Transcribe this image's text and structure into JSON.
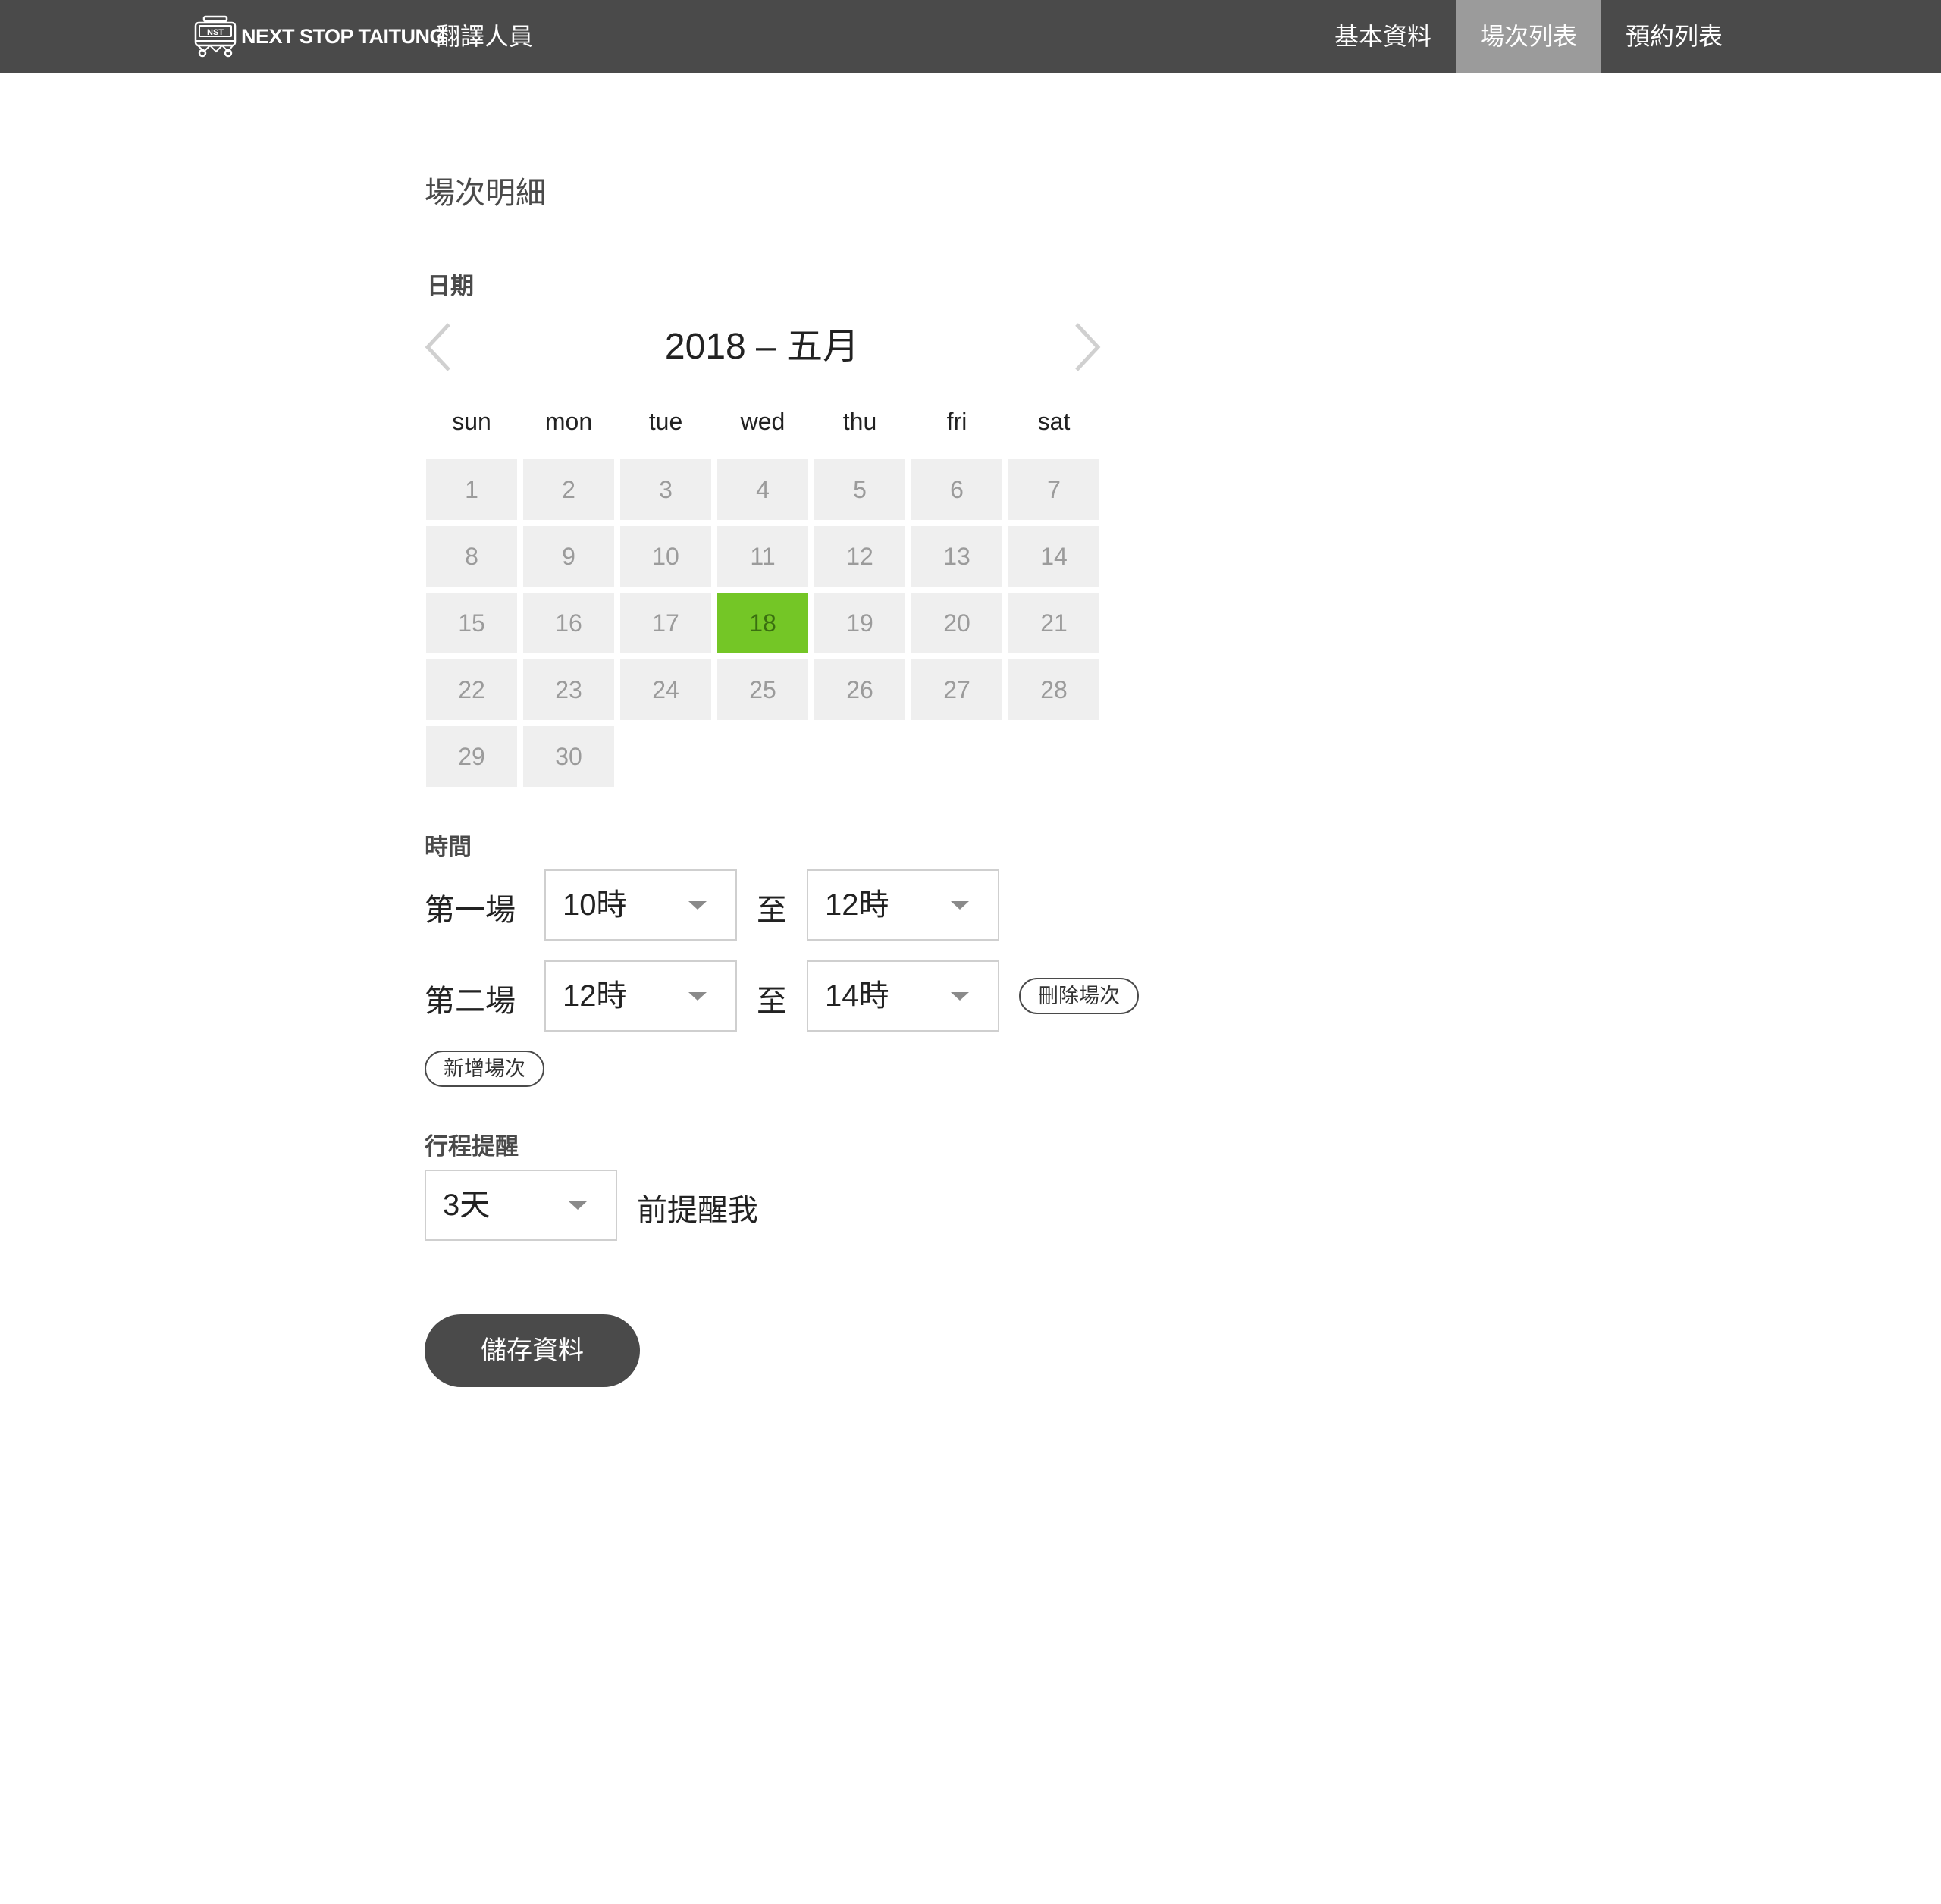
{
  "header": {
    "brand": "NEXT STOP TAITUNG",
    "logo_text": "NST",
    "role": "翻譯人員",
    "nav": [
      {
        "label": "基本資料",
        "active": false
      },
      {
        "label": "場次列表",
        "active": true
      },
      {
        "label": "預約列表",
        "active": false
      }
    ],
    "active_color": "#9b9b9b",
    "bar_color": "#4a4a4a"
  },
  "page": {
    "title": "場次明細",
    "date_label": "日期",
    "time_label": "時間",
    "reminder_label": "行程提醒"
  },
  "calendar": {
    "month_title": "2018 – 五月",
    "prev_icon": "chevron-left-icon",
    "next_icon": "chevron-right-icon",
    "weekdays": [
      "sun",
      "mon",
      "tue",
      "wed",
      "thu",
      "fri",
      "sat"
    ],
    "days": [
      "1",
      "2",
      "3",
      "4",
      "5",
      "6",
      "7",
      "8",
      "9",
      "10",
      "11",
      "12",
      "13",
      "14",
      "15",
      "16",
      "17",
      "18",
      "19",
      "20",
      "21",
      "22",
      "23",
      "24",
      "25",
      "26",
      "27",
      "28",
      "29",
      "30"
    ],
    "selected_day": "18",
    "selected_color": "#74c626"
  },
  "sessions": [
    {
      "label": "第一場",
      "start": "10時",
      "to": "至",
      "end": "12時",
      "delete_label": ""
    },
    {
      "label": "第二場",
      "start": "12時",
      "to": "至",
      "end": "14時",
      "delete_label": "刪除場次"
    }
  ],
  "add_session_label": "新增場次",
  "reminder": {
    "value": "3天",
    "suffix": "前提醒我"
  },
  "save_label": "儲存資料"
}
